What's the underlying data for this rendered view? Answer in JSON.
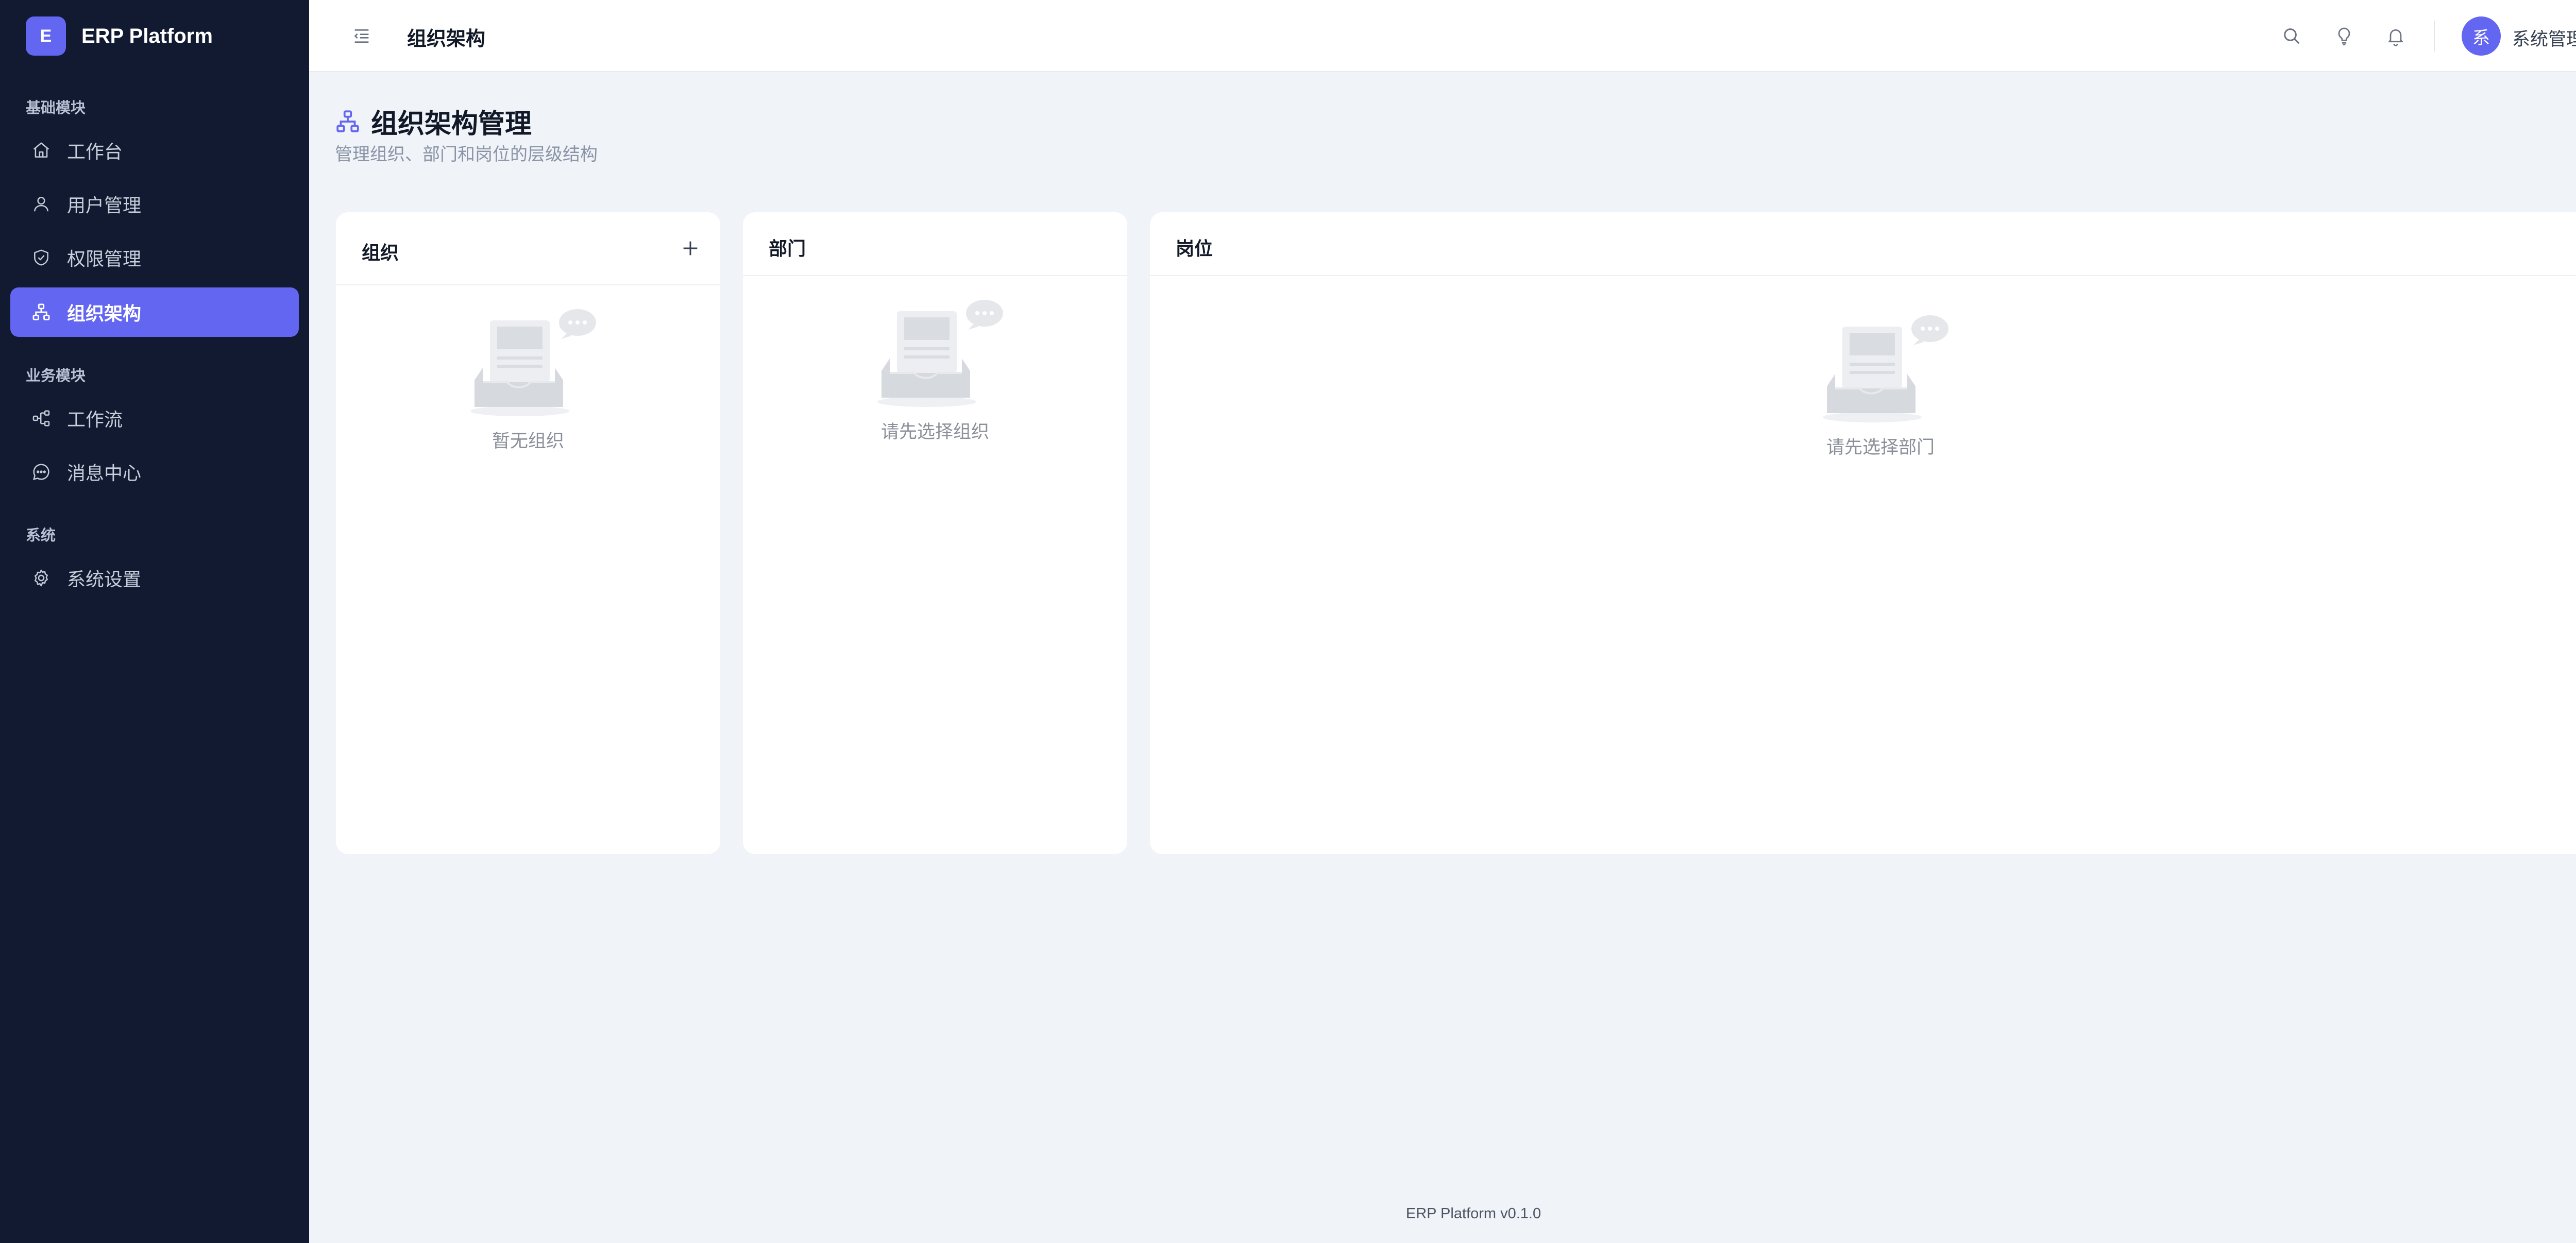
{
  "app": {
    "logo_letter": "E",
    "name": "ERP Platform"
  },
  "sidebar": {
    "sections": [
      {
        "title": "基础模块",
        "items": [
          {
            "label": "工作台",
            "icon": "home-icon",
            "active": false
          },
          {
            "label": "用户管理",
            "icon": "user-icon",
            "active": false
          },
          {
            "label": "权限管理",
            "icon": "shield-icon",
            "active": false
          },
          {
            "label": "组织架构",
            "icon": "org-chart-icon",
            "active": true
          }
        ]
      },
      {
        "title": "业务模块",
        "items": [
          {
            "label": "工作流",
            "icon": "workflow-icon",
            "active": false
          },
          {
            "label": "消息中心",
            "icon": "message-icon",
            "active": false
          }
        ]
      },
      {
        "title": "系统",
        "items": [
          {
            "label": "系统设置",
            "icon": "gear-icon",
            "active": false
          }
        ]
      }
    ]
  },
  "header": {
    "collapse_icon": "menu-collapse-icon",
    "title": "组织架构",
    "actions": [
      "search-icon",
      "lightbulb-icon",
      "bell-icon"
    ],
    "user": {
      "avatar_text": "系",
      "name": "系统管理员"
    }
  },
  "page": {
    "title": "组织架构管理",
    "subtitle": "管理组织、部门和岗位的层级结构"
  },
  "panels": {
    "organization": {
      "title": "组织",
      "add_icon": "plus-icon",
      "empty_text": "暂无组织"
    },
    "department": {
      "title": "部门",
      "empty_text": "请先选择组织"
    },
    "position": {
      "title": "岗位",
      "empty_text": "请先选择部门"
    }
  },
  "footer": {
    "version_text": "ERP Platform v0.1.0"
  },
  "colors": {
    "sidebar_bg": "#111a30",
    "accent": "#6366f1",
    "page_bg": "#f0f3f8",
    "card_bg": "#ffffff"
  }
}
